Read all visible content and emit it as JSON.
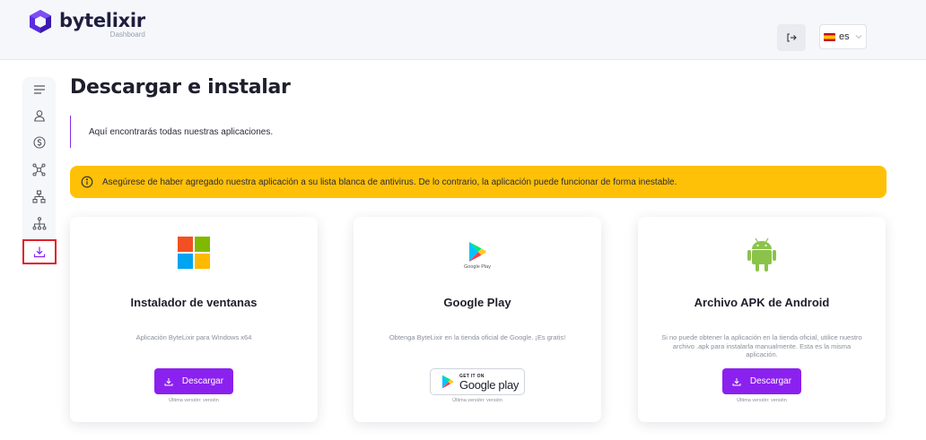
{
  "header": {
    "brand": "bytelixir",
    "subtitle": "Dashboard",
    "language": "es"
  },
  "sidebar": {
    "items": [
      {
        "icon": "menu-icon"
      },
      {
        "icon": "user-icon"
      },
      {
        "icon": "dollar-icon"
      },
      {
        "icon": "network-icon"
      },
      {
        "icon": "sitemap-icon"
      },
      {
        "icon": "hierarchy-icon"
      },
      {
        "icon": "download-icon",
        "active": true
      }
    ]
  },
  "main": {
    "title": "Descargar e instalar",
    "intro": "Aquí encontrarás todas nuestras aplicaciones.",
    "alert": "Asegúrese de haber agregado nuestra aplicación a su lista blanca de antivirus. De lo contrario, la aplicación puede funcionar de forma inestable."
  },
  "cards": [
    {
      "title": "Instalador de ventanas",
      "description": "Aplicación ByteLixir para Windows x64",
      "button": "Descargar",
      "version": "Última versión: versión"
    },
    {
      "title": "Google Play",
      "icon_label": "Google Play",
      "description": "Obtenga ByteLixir en la tienda oficial de Google. ¡Es gratis!",
      "badge_small": "GET IT ON",
      "badge_big": "Google play",
      "version": "Última versión: versión"
    },
    {
      "title": "Archivo APK de Android",
      "description": "Si no puede obtener la aplicación en la tienda oficial, utilice nuestro archivo .apk para instalarla manualmente. Esta es la misma aplicación.",
      "button": "Descargar",
      "version": "Última versión: versión"
    }
  ],
  "colors": {
    "accent": "#8b21ee",
    "alert": "#ffc107",
    "active_outline": "#e0202a"
  }
}
